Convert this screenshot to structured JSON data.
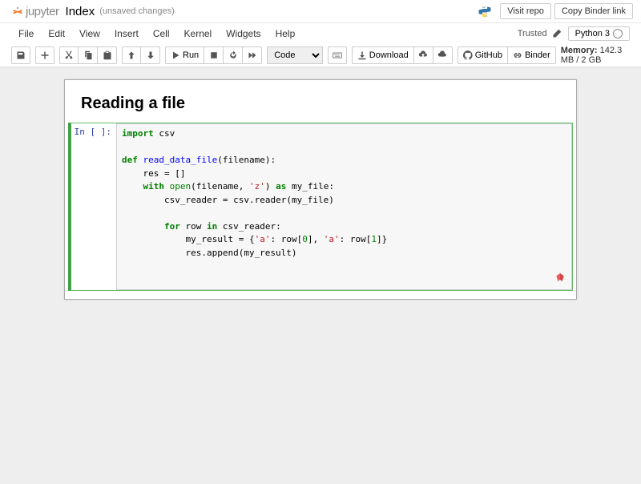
{
  "header": {
    "logo_text": "jupyter",
    "notebook_title": "Index",
    "save_status": "(unsaved changes)",
    "buttons": {
      "visit_repo": "Visit repo",
      "copy_binder": "Copy Binder link"
    }
  },
  "menubar": {
    "items": [
      "File",
      "Edit",
      "View",
      "Insert",
      "Cell",
      "Kernel",
      "Widgets",
      "Help"
    ],
    "trusted": "Trusted",
    "kernel": "Python 3"
  },
  "toolbar": {
    "run_label": "Run",
    "download_label": "Download",
    "github_label": "GitHub",
    "binder_label": "Binder",
    "celltype_selected": "Code",
    "memory_label": "Memory:",
    "memory_value": "142.3 MB / 2 GB",
    "icons": {
      "save": "save-icon",
      "add": "plus-icon",
      "cut": "cut-icon",
      "copy": "copy-icon",
      "paste": "paste-icon",
      "up": "arrow-up-icon",
      "down": "arrow-down-icon",
      "run": "play-icon",
      "stop": "stop-icon",
      "restart": "restart-icon",
      "fastforward": "fast-forward-icon",
      "keyboard": "keyboard-icon",
      "download": "download-icon",
      "cloud_up": "cloud-upload-icon",
      "cloud_down": "cloud-download-icon",
      "github": "github-icon",
      "binder": "link-icon"
    }
  },
  "notebook": {
    "markdown_heading": "Reading a file",
    "prompt": "In [ ]:",
    "code_tokens": [
      [
        "kw-import",
        "import"
      ],
      [
        "",
        " csv"
      ],
      [
        "br",
        ""
      ],
      [
        "br",
        ""
      ],
      [
        "kw-def",
        "def"
      ],
      [
        "",
        " "
      ],
      [
        "fn",
        "read_data_file"
      ],
      [
        "",
        "(filename):"
      ],
      [
        "br",
        ""
      ],
      [
        "",
        "    res "
      ],
      [
        "",
        "="
      ],
      [
        "",
        " []"
      ],
      [
        "br",
        ""
      ],
      [
        "",
        "    "
      ],
      [
        "kw-with",
        "with"
      ],
      [
        "",
        " "
      ],
      [
        "builtin",
        "open"
      ],
      [
        "",
        "(filename, "
      ],
      [
        "str",
        "'z'"
      ],
      [
        "",
        ") "
      ],
      [
        "kw-as",
        "as"
      ],
      [
        "",
        " my_file:"
      ],
      [
        "br",
        ""
      ],
      [
        "",
        "        csv_reader "
      ],
      [
        "",
        "="
      ],
      [
        "",
        " csv.reader(my_file)"
      ],
      [
        "br",
        ""
      ],
      [
        "br",
        ""
      ],
      [
        "",
        "        "
      ],
      [
        "kw-for",
        "for"
      ],
      [
        "",
        " row "
      ],
      [
        "kw-in",
        "in"
      ],
      [
        "",
        " csv_reader:"
      ],
      [
        "br",
        ""
      ],
      [
        "",
        "            my_result "
      ],
      [
        "",
        "="
      ],
      [
        "",
        " {"
      ],
      [
        "str",
        "'a'"
      ],
      [
        "",
        ": row["
      ],
      [
        "num",
        "0"
      ],
      [
        "",
        "], "
      ],
      [
        "str",
        "'a'"
      ],
      [
        "",
        ": row["
      ],
      [
        "num",
        "1"
      ],
      [
        "",
        "]}"
      ],
      [
        "br",
        ""
      ],
      [
        "",
        "            res.append(my_result)"
      ]
    ]
  }
}
